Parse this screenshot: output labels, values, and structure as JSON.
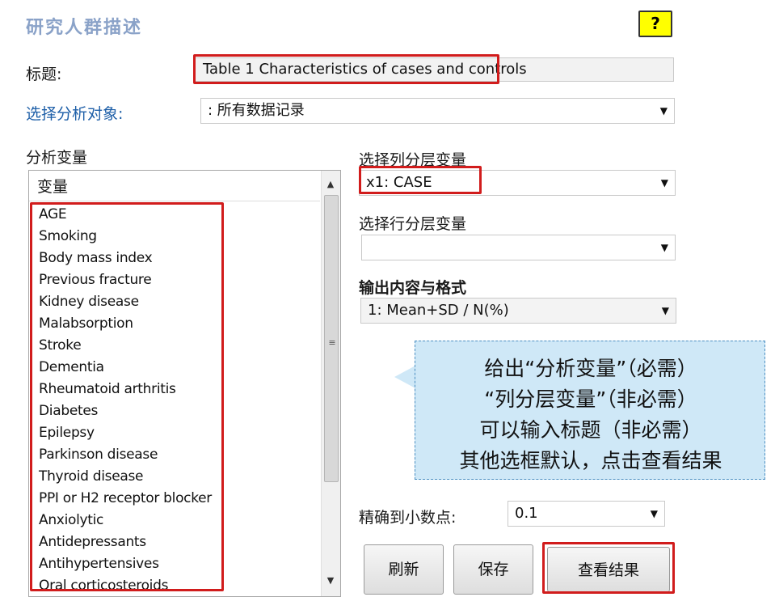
{
  "window_title": "研究人群描述",
  "help_label": "?",
  "title_label": "标题:",
  "title_value": "Table 1 Characteristics of cases and controls",
  "subject_label": "选择分析对象:",
  "subject_value": ": 所有数据记录",
  "var_section_label": "分析变量",
  "var_list_header": "变量",
  "variables": [
    "AGE",
    "Smoking",
    "Body mass index",
    "Previous fracture",
    "Kidney disease",
    "Malabsorption",
    "Stroke",
    "Dementia",
    "Rheumatoid arthritis",
    "Diabetes",
    "Epilepsy",
    "Parkinson disease",
    "Thyroid disease",
    "PPI or H2 receptor blocker",
    "Anxiolytic",
    "Antidepressants",
    "Antihypertensives",
    "Oral corticosteroids"
  ],
  "col_strat_label": "选择列分层变量",
  "col_strat_value": "x1: CASE",
  "row_strat_label": "选择行分层变量",
  "row_strat_value": "",
  "output_label": "输出内容与格式",
  "output_value": "1: Mean+SD / N(%)",
  "callout_lines": [
    "给出“分析变量”（必需）",
    "“列分层变量”（非必需）",
    "可以输入标题（非必需）",
    "其他选框默认，点击查看结果"
  ],
  "decimal_label": "精确到小数点:",
  "decimal_value": "0.1",
  "buttons": {
    "refresh": "刷新",
    "save": "保存",
    "view": "查看结果"
  },
  "colors": {
    "highlight": "#d11c1c",
    "callout_bg": "#cfe8f7",
    "title": "#8aa2c8",
    "link_label": "#1e5fa8",
    "help_bg": "#ffff00"
  },
  "icons": {
    "dropdown": "chevron-down-icon",
    "scroll_up": "scroll-up-icon",
    "scroll_down": "scroll-down-icon"
  }
}
